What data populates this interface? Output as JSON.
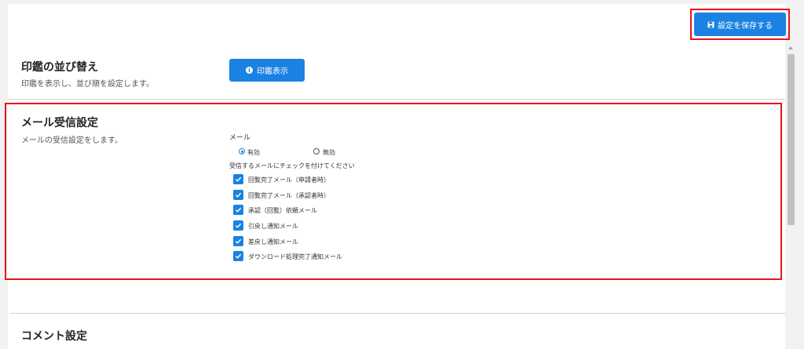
{
  "toolbar": {
    "save_label": "設定を保存する"
  },
  "seal_section": {
    "title": "印鑑の並び替え",
    "description": "印鑑を表示し、並び順を設定します。",
    "button_label": "印鑑表示"
  },
  "mail_section": {
    "title": "メール受信設定",
    "description": "メールの受信設定をします。",
    "mail_label": "メール",
    "radio_enabled": "有効",
    "radio_disabled": "無効",
    "selected": "有効",
    "instruction": "受信するメールにチェックを付けてください",
    "checkboxes": [
      {
        "label": "回覧完了メール（申請者時）",
        "checked": true
      },
      {
        "label": "回覧完了メール（承認者時）",
        "checked": true
      },
      {
        "label": "承認（回覧）依頼メール",
        "checked": true
      },
      {
        "label": "引戻し通知メール",
        "checked": true
      },
      {
        "label": "差戻し通知メール",
        "checked": true
      },
      {
        "label": "ダウンロード処理完了通知メール",
        "checked": true
      }
    ]
  },
  "comment_section": {
    "title": "コメント設定"
  },
  "colors": {
    "primary": "#1a82e2",
    "highlight": "#e8141c",
    "background": "#f2f2f2"
  },
  "icons": {
    "save": "floppy-disk-icon",
    "info": "info-circle-icon",
    "check": "check-icon"
  }
}
